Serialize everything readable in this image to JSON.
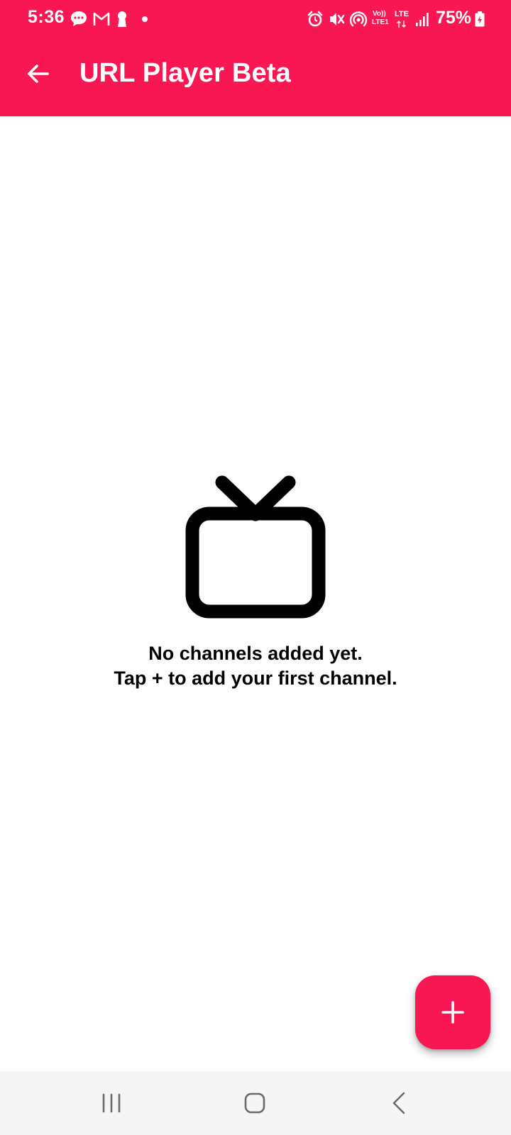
{
  "status_bar": {
    "time": "5:36",
    "battery_percent": "75%",
    "volte_label_top": "Vo))",
    "volte_label_bottom": "LTE1",
    "lte_label": "LTE",
    "notification_icons": [
      "chat-bubble-icon",
      "gmail-icon",
      "keyhole-icon",
      "dot-icon"
    ],
    "system_icons": [
      "alarm-icon",
      "mute-icon",
      "hotspot-icon",
      "volte-icon",
      "lte-icon",
      "signal-icon",
      "battery-charging-icon"
    ]
  },
  "toolbar": {
    "title": "URL Player Beta",
    "back_icon": "arrow-back-icon"
  },
  "empty_state": {
    "icon": "tv-icon",
    "line1": "No channels added yet.",
    "line2": "Tap + to add your first channel."
  },
  "fab": {
    "icon": "plus-icon"
  },
  "navigation_bar": {
    "buttons": [
      "recent-apps-icon",
      "home-icon",
      "back-icon"
    ]
  },
  "colors": {
    "accent": "#F81752",
    "background": "#FFFFFF",
    "nav_background": "#F5F5F5",
    "text_primary": "#000000"
  }
}
